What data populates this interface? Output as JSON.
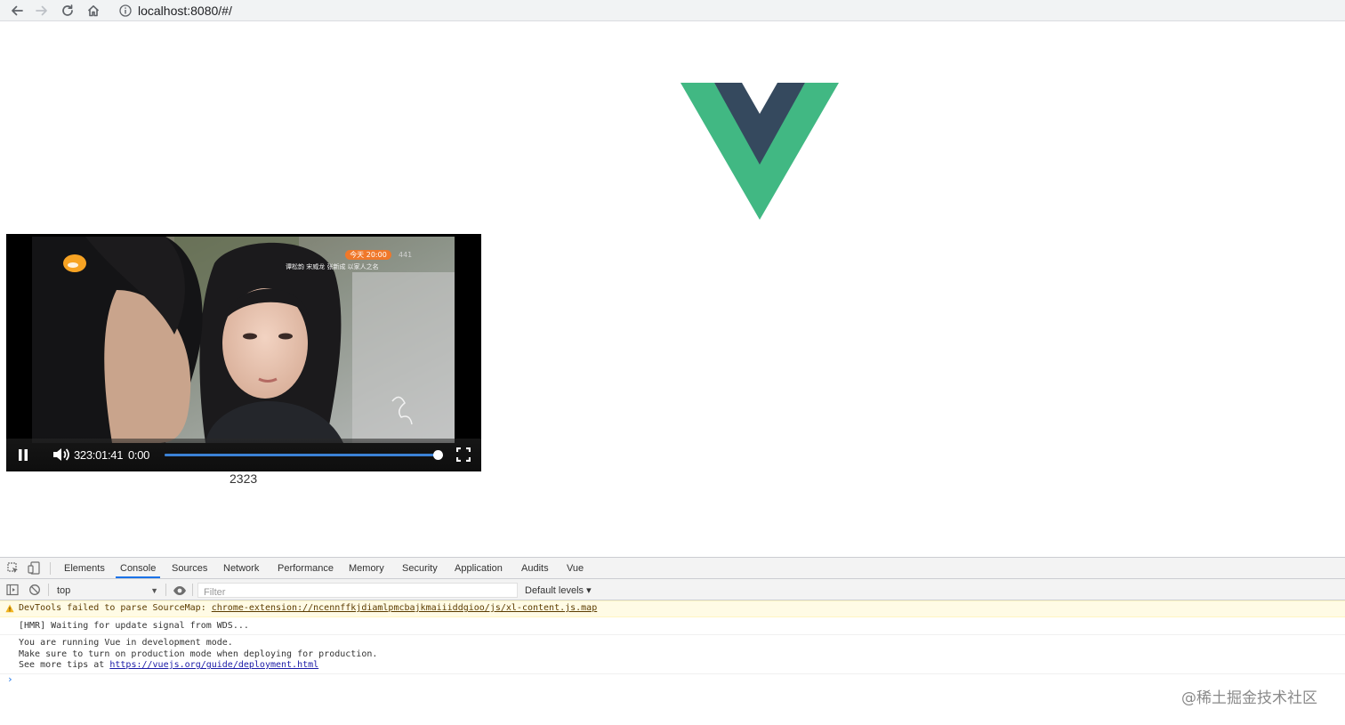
{
  "browser": {
    "url": "localhost:8080/#/",
    "icons": [
      "back-arrow-icon",
      "forward-arrow-icon",
      "reload-icon",
      "home-icon",
      "info-icon"
    ]
  },
  "page": {
    "logo_icon": "vue-logo",
    "logo_colors": {
      "green": "#41b883",
      "dark": "#35495e"
    },
    "caption": "2323"
  },
  "video": {
    "current_time": "323:01:41",
    "duration": "0:00",
    "progress_fraction": 0.99,
    "accent_color": "#3b82d6",
    "overlay": {
      "pill_text": "今天 20:00",
      "cast_text": "谭松韵 宋威龙 张新成 以家人之名",
      "rating_text": "441"
    }
  },
  "devtools": {
    "tabs": [
      {
        "label": "Elements"
      },
      {
        "label": "Console"
      },
      {
        "label": "Sources"
      },
      {
        "label": "Network"
      },
      {
        "label": "Performance"
      },
      {
        "label": "Memory"
      },
      {
        "label": "Security"
      },
      {
        "label": "Application"
      },
      {
        "label": "Audits"
      },
      {
        "label": "Vue"
      }
    ],
    "active_tab": "Console",
    "context": "top",
    "filter_placeholder": "Filter",
    "levels": "Default levels ▾",
    "messages": {
      "warn_prefix": "DevTools failed to parse SourceMap: ",
      "warn_link": "chrome-extension://ncennffkjdiamlpmcbajkmaiiiddgioo/js/xl-content.js.map",
      "hmr": "[HMR] Waiting for update signal from WDS...",
      "vue_line1": "You are running Vue in development mode.",
      "vue_line2": "Make sure to turn on production mode when deploying for production.",
      "vue_line3_prefix": "See more tips at ",
      "vue_link": "https://vuejs.org/guide/deployment.html"
    },
    "prompt": "›"
  },
  "watermark": "@稀土掘金技术社区"
}
